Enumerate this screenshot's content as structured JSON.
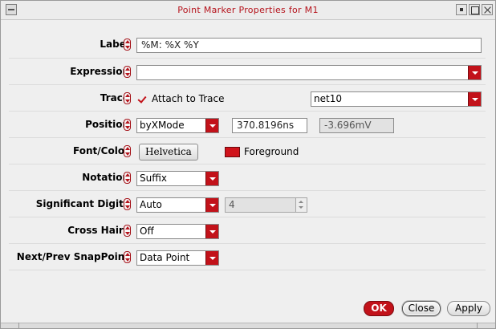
{
  "window": {
    "title": "Point Marker Properties for M1"
  },
  "fields": {
    "label": {
      "label": "Label",
      "value": "%M: %X %Y"
    },
    "expression": {
      "label": "Expression",
      "value": ""
    },
    "trace": {
      "label": "Trace",
      "checkbox_label": "Attach to Trace",
      "checked": true,
      "selected": "net10"
    },
    "position": {
      "label": "Position",
      "mode": "byXMode",
      "x_value": "370.8196ns",
      "y_value": "-3.696mV"
    },
    "font_color": {
      "label": "Font/Color",
      "font_button": "Helvetica",
      "color_label": "Foreground",
      "color": "#d0131b"
    },
    "notation": {
      "label": "Notation",
      "selected": "Suffix"
    },
    "significant_digits": {
      "label": "Significant Digits",
      "selected": "Auto",
      "value": "4"
    },
    "cross_hairs": {
      "label": "Cross Hairs",
      "selected": "Off"
    },
    "snap_point": {
      "label": "Next/Prev SnapPoint",
      "selected": "Data Point"
    }
  },
  "buttons": {
    "ok": "OK",
    "close": "Close",
    "apply": "Apply"
  },
  "colors": {
    "accent": "#c2121a",
    "title_text": "#b5121b",
    "background": "#efefef"
  }
}
